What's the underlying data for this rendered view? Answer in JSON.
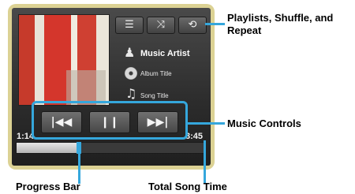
{
  "buttons": {
    "playlists_icon": "list-icon",
    "shuffle_icon": "shuffle-icon",
    "repeat_icon": "repeat-icon"
  },
  "track": {
    "artist": "Music Artist",
    "album": "Album Title",
    "song": "Song Title"
  },
  "times": {
    "elapsed": "1:14",
    "total": "3:45"
  },
  "progress": {
    "fraction": 0.33
  },
  "callouts": {
    "top_controls": "Playlists, Shuffle, and Repeat",
    "music_controls": "Music Controls",
    "progress_bar": "Progress Bar",
    "total_time": "Total Song Time"
  },
  "colors": {
    "accent": "#35a7dc",
    "frame": "#dcd294"
  }
}
